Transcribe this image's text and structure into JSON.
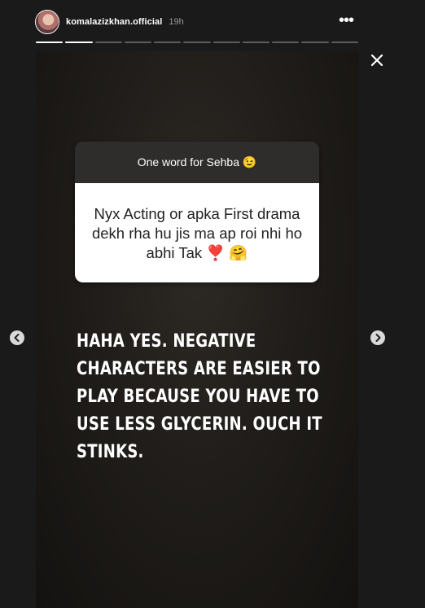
{
  "header": {
    "username": "komalazizkhan.official",
    "time": "19h",
    "more_icon": "more-dots-icon",
    "progress_segments_total": 11,
    "progress_segments_done": 2
  },
  "story": {
    "question_sticker": {
      "header": "One word for Sehba 😉",
      "question": "Nyx Acting or apka First drama dekh rha hu jis ma ap roi nhi ho abhi Tak ❣️ 🤗"
    },
    "answer_text": "Haha yes. Negative characters are easier to play because you have to use less glycerin. Ouch it stinks."
  },
  "controls": {
    "close_icon": "close-icon",
    "prev_icon": "chevron-left-icon",
    "next_icon": "chevron-right-icon"
  },
  "colors": {
    "page_background": "#1a1a1a",
    "sticker_header": "#2e2d2c",
    "sticker_body": "#ffffff"
  }
}
